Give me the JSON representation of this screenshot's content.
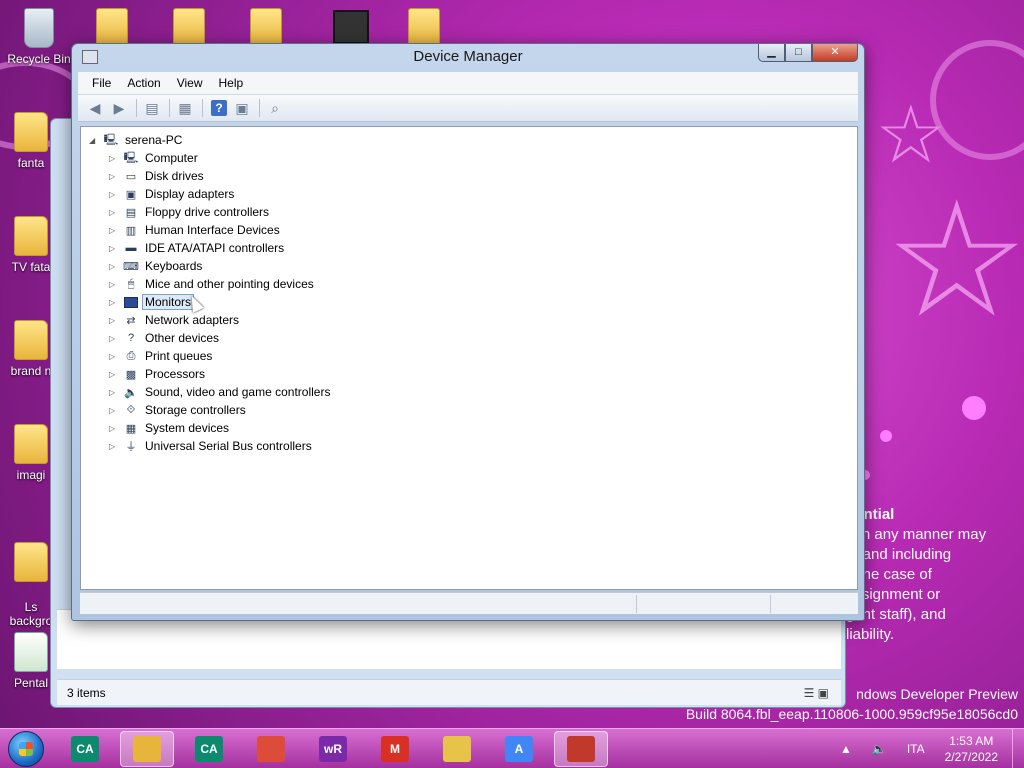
{
  "desktop": {
    "icons": [
      {
        "label": "Recycle Bin"
      },
      {
        "label": "fanta"
      },
      {
        "label": "TV  fata"
      },
      {
        "label": "brand n"
      },
      {
        "label": "imagi"
      },
      {
        "label": "Ls\nbackgro"
      },
      {
        "label": "Pental"
      }
    ]
  },
  "background_window": {
    "status_text": "3 items"
  },
  "wallpaper_text": {
    "line1": "dential",
    "line2": "e in any manner may",
    "line3": " to and including",
    "line4": "n the case of",
    "line5": "assignment or",
    "line6": "gent staff), and",
    "line7": "liability.",
    "build1": "ndows Developer Preview",
    "build2": "Build 8064.fbl_eeap.110806-1000.959cf95e18056cd0"
  },
  "device_manager": {
    "title": "Device Manager",
    "menu": [
      "File",
      "Action",
      "View",
      "Help"
    ],
    "root": "serena-PC",
    "tree": [
      {
        "label": "Computer",
        "icon": "computer-icon"
      },
      {
        "label": "Disk drives",
        "icon": "disk-drive-icon"
      },
      {
        "label": "Display adapters",
        "icon": "display-adapter-icon"
      },
      {
        "label": "Floppy drive controllers",
        "icon": "floppy-controller-icon"
      },
      {
        "label": "Human Interface Devices",
        "icon": "hid-icon"
      },
      {
        "label": "IDE ATA/ATAPI controllers",
        "icon": "ide-controller-icon"
      },
      {
        "label": "Keyboards",
        "icon": "keyboard-icon"
      },
      {
        "label": "Mice and other pointing devices",
        "icon": "mouse-icon"
      },
      {
        "label": "Monitors",
        "icon": "monitor-icon",
        "selected": true
      },
      {
        "label": "Network adapters",
        "icon": "network-adapter-icon"
      },
      {
        "label": "Other devices",
        "icon": "other-devices-icon"
      },
      {
        "label": "Print queues",
        "icon": "printer-icon"
      },
      {
        "label": "Processors",
        "icon": "processor-icon"
      },
      {
        "label": "Sound, video and game controllers",
        "icon": "sound-icon"
      },
      {
        "label": "Storage controllers",
        "icon": "storage-controller-icon"
      },
      {
        "label": "System devices",
        "icon": "system-devices-icon"
      },
      {
        "label": "Universal Serial Bus controllers",
        "icon": "usb-icon"
      }
    ]
  },
  "taskbar": {
    "apps": [
      {
        "name": "credit-agricole-icon",
        "glyph": "CA",
        "color": "#0c8a6e"
      },
      {
        "name": "explorer-icon",
        "glyph": "",
        "color": "#e8b53c",
        "active": true
      },
      {
        "name": "credit-agricole-icon",
        "glyph": "CA",
        "color": "#0c8a6e"
      },
      {
        "name": "chrome-icon",
        "glyph": "",
        "color": "#dd4b39"
      },
      {
        "name": "wr-icon",
        "glyph": "wR",
        "color": "#7a2aa8"
      },
      {
        "name": "gmail-icon",
        "glyph": "M",
        "color": "#d93025"
      },
      {
        "name": "notes-icon",
        "glyph": "",
        "color": "#e8c34a"
      },
      {
        "name": "translate-icon",
        "glyph": "A",
        "color": "#4285f4"
      },
      {
        "name": "device-manager-icon",
        "glyph": "",
        "color": "#c0392b",
        "active": true
      }
    ],
    "language": "ITA",
    "time": "1:53 AM",
    "date": "2/27/2022"
  }
}
